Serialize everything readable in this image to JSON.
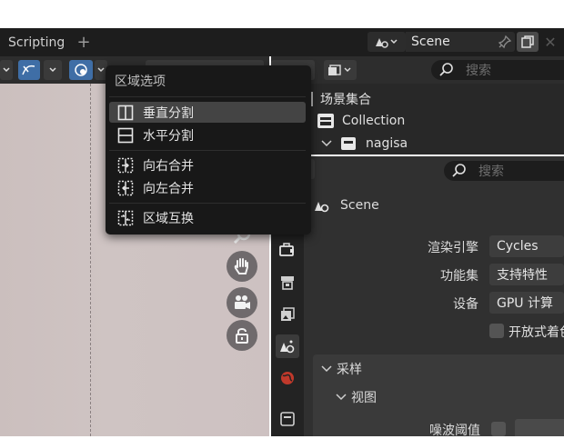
{
  "topbar": {
    "workspace_tab": "Scripting",
    "add_workspace": "+",
    "scene_name": "Scene"
  },
  "area_menu": {
    "title": "区域选项",
    "items": [
      {
        "label": "垂直分割",
        "icon": "split-vertical-icon",
        "highlighted": true
      },
      {
        "label": "水平分割",
        "icon": "split-horizontal-icon",
        "highlighted": false
      },
      {
        "label": "向右合并",
        "icon": "join-right-icon",
        "highlighted": false
      },
      {
        "label": "向左合并",
        "icon": "join-left-icon",
        "highlighted": false
      },
      {
        "label": "区域互换",
        "icon": "swap-areas-icon",
        "highlighted": false
      }
    ]
  },
  "outliner": {
    "search_placeholder": "搜索",
    "root": "场景集合",
    "collection": "Collection",
    "object": "nagisa"
  },
  "properties": {
    "search_placeholder": "搜索",
    "context": "Scene",
    "render_engine_label": "渲染引擎",
    "render_engine_value": "Cycles",
    "feature_set_label": "功能集",
    "feature_set_value": "支持特性",
    "device_label": "设备",
    "device_value": "GPU 计算",
    "open_shading_label": "开放式着色",
    "sampling_panel": "采样",
    "viewport_subpanel": "视图",
    "noise_threshold_label": "噪波阈值"
  },
  "colors": {
    "accent": "#3f6ea6",
    "menu_bg": "#181818",
    "highlight": "#444444",
    "scene_red": "#c0392b"
  }
}
